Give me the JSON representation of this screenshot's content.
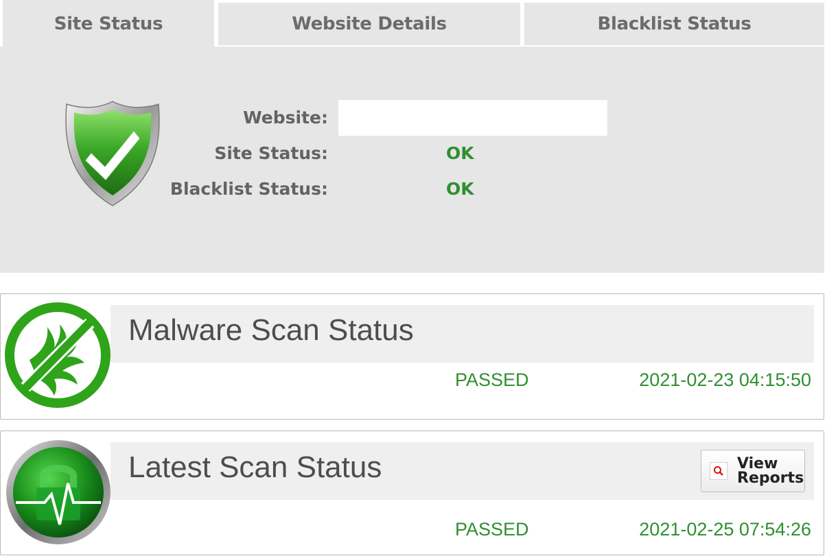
{
  "tabs": [
    {
      "label": "Site Status",
      "active": true
    },
    {
      "label": "Website Details",
      "active": false
    },
    {
      "label": "Blacklist Status",
      "active": false
    }
  ],
  "site_status": {
    "icon": "shield-check-icon",
    "website_label": "Website:",
    "website_value": "",
    "site_status_label": "Site Status:",
    "site_status_value": "OK",
    "blacklist_label": "Blacklist Status:",
    "blacklist_value": "OK"
  },
  "malware_scan": {
    "icon": "no-malware-icon",
    "title": "Malware Scan Status",
    "result": "PASSED",
    "timestamp": "2021-02-23 04:15:50"
  },
  "latest_scan": {
    "icon": "lock-heartbeat-icon",
    "title": "Latest Scan Status",
    "view_reports_line1": "View",
    "view_reports_line2": "Reports",
    "result": "PASSED",
    "timestamp": "2021-02-25 07:54:26"
  },
  "colors": {
    "ok_green": "#2f8f2f",
    "panel_bg": "#e6e6e6",
    "label_gray": "#636363"
  }
}
